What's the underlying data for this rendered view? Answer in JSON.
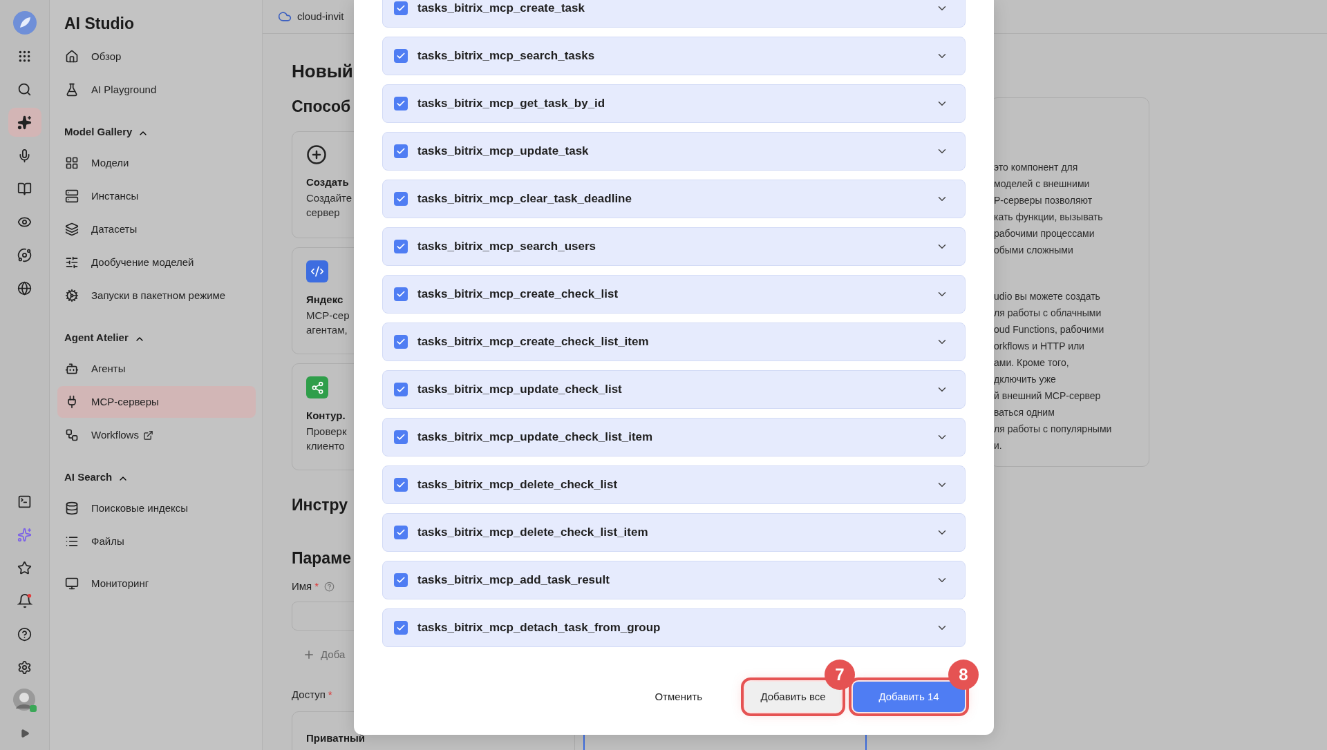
{
  "rail": {
    "top": [
      {
        "kind": "logo",
        "selected": false
      },
      {
        "kind": "apps",
        "selected": false
      },
      {
        "kind": "search",
        "selected": false
      },
      {
        "kind": "sparkle",
        "selected": true
      },
      {
        "kind": "mic",
        "selected": false
      },
      {
        "kind": "book",
        "selected": false
      },
      {
        "kind": "eye",
        "selected": false
      },
      {
        "kind": "orbit",
        "selected": false
      },
      {
        "kind": "globe",
        "selected": false
      }
    ],
    "bottom": [
      {
        "kind": "terminal",
        "selected": false
      },
      {
        "kind": "magic",
        "selected": false
      },
      {
        "kind": "star",
        "selected": false
      },
      {
        "kind": "bell-alert",
        "selected": false
      },
      {
        "kind": "help",
        "selected": false
      },
      {
        "kind": "settings",
        "selected": false
      },
      {
        "kind": "avatar",
        "selected": false
      },
      {
        "kind": "expand",
        "selected": false
      }
    ]
  },
  "sidebar": {
    "title": "AI Studio",
    "sections": [
      {
        "items": [
          {
            "label": "Обзор",
            "kind": "home",
            "selected": false,
            "external": false
          },
          {
            "label": "AI Playground",
            "kind": "flask",
            "selected": false,
            "external": false
          }
        ]
      },
      {
        "heading": "Model Gallery",
        "expanded": true,
        "items": [
          {
            "label": "Модели",
            "kind": "grid",
            "selected": false,
            "external": false
          },
          {
            "label": "Инстансы",
            "kind": "server",
            "selected": false,
            "external": false
          },
          {
            "label": "Датасеты",
            "kind": "layers",
            "selected": false,
            "external": false
          },
          {
            "label": "Дообучение моделей",
            "kind": "sliders",
            "selected": false,
            "external": false
          },
          {
            "label": "Запуски в пакетном режиме",
            "kind": "cog",
            "selected": false,
            "external": false
          }
        ]
      },
      {
        "heading": "Agent Atelier",
        "expanded": true,
        "items": [
          {
            "label": "Агенты",
            "kind": "bot",
            "selected": false,
            "external": false
          },
          {
            "label": "MCP-серверы",
            "kind": "plug",
            "selected": true,
            "external": false
          },
          {
            "label": "Workflows",
            "kind": "workflow",
            "selected": false,
            "external": true
          }
        ]
      },
      {
        "heading": "AI Search",
        "expanded": true,
        "items": [
          {
            "label": "Поисковые индексы",
            "kind": "database",
            "selected": false,
            "external": false
          },
          {
            "label": "Файлы",
            "kind": "list",
            "selected": false,
            "external": false
          }
        ]
      },
      {
        "items": [
          {
            "label": "Мониторинг",
            "kind": "monitor",
            "selected": false,
            "external": false
          }
        ]
      }
    ]
  },
  "breadcrumb": "cloud-invit",
  "main": {
    "title": "Новый",
    "subtitle": "Способ",
    "cards": [
      {
        "kind": "create",
        "title": "Создать",
        "lines": [
          "Создайте",
          "сервер"
        ]
      },
      {
        "kind": "yandex",
        "title": "Яндекс",
        "lines": [
          "MCP-сер",
          "агентам,"
        ]
      },
      {
        "kind": "kontur",
        "title": "Контур.",
        "lines": [
          "Проверк",
          "клиенто"
        ]
      }
    ],
    "tools_heading": "Инстру",
    "params_heading": "Параме",
    "name_field": {
      "label": "Имя",
      "required_mark": "*"
    },
    "add_link": "Доба",
    "access": {
      "label": "Доступ",
      "required_mark": "*",
      "options": [
        {
          "title": "Приватный",
          "selected": false
        },
        {
          "selected": true
        }
      ]
    }
  },
  "info_panel": {
    "paragraphs": [
      [
        "это компонент для",
        "моделей с внешними",
        "P-серверы позволяют",
        "кать функции, вызывать",
        "рабочими процессами",
        "обыми сложными"
      ],
      [
        "udio вы можете создать",
        "ля работы с облачными",
        "oud Functions, рабочими",
        "orkflows и HTTP или",
        "ами. Кроме того,",
        "дключить уже",
        "й внешний MCP-сервер",
        "ваться одним",
        "ля работы с популярными",
        "и."
      ]
    ]
  },
  "modal": {
    "tools": [
      {
        "name": "tasks_bitrix_mcp_create_task",
        "checked": true
      },
      {
        "name": "tasks_bitrix_mcp_search_tasks",
        "checked": true
      },
      {
        "name": "tasks_bitrix_mcp_get_task_by_id",
        "checked": true
      },
      {
        "name": "tasks_bitrix_mcp_update_task",
        "checked": true
      },
      {
        "name": "tasks_bitrix_mcp_clear_task_deadline",
        "checked": true
      },
      {
        "name": "tasks_bitrix_mcp_search_users",
        "checked": true
      },
      {
        "name": "tasks_bitrix_mcp_create_check_list",
        "checked": true
      },
      {
        "name": "tasks_bitrix_mcp_create_check_list_item",
        "checked": true
      },
      {
        "name": "tasks_bitrix_mcp_update_check_list",
        "checked": true
      },
      {
        "name": "tasks_bitrix_mcp_update_check_list_item",
        "checked": true
      },
      {
        "name": "tasks_bitrix_mcp_delete_check_list",
        "checked": true
      },
      {
        "name": "tasks_bitrix_mcp_delete_check_list_item",
        "checked": true
      },
      {
        "name": "tasks_bitrix_mcp_add_task_result",
        "checked": true
      },
      {
        "name": "tasks_bitrix_mcp_detach_task_from_group",
        "checked": true
      }
    ],
    "buttons": [
      {
        "kind": "cancel",
        "label": "Отменить"
      },
      {
        "kind": "secondary",
        "label": "Добавить все",
        "callout": "7"
      },
      {
        "kind": "primary",
        "label": "Добавить 14",
        "callout": "8"
      }
    ]
  }
}
